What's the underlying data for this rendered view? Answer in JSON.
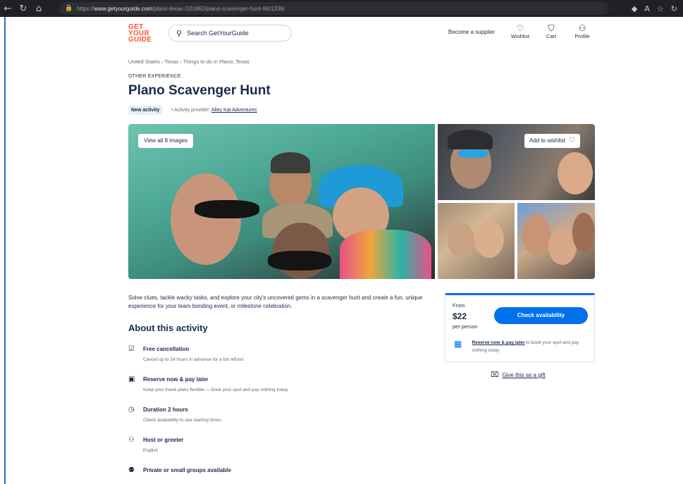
{
  "browser": {
    "url_prefix": "https://",
    "url_host": "www.getyourguide.com",
    "url_path": "/plano-texas-l101862/plano-scavenger-hunt-t601336/"
  },
  "header": {
    "logo_lines": [
      "GET",
      "YOUR",
      "GUIDE"
    ],
    "search_placeholder": "Search GetYourGuide",
    "become_supplier": "Become a supplier",
    "wishlist": "Wishlist",
    "cart": "Cart",
    "profile": "Profile"
  },
  "breadcrumb": "United States › Texas › Things to do in Plano, Texas",
  "overline": "OTHER EXPERIENCE",
  "title": "Plano Scavenger Hunt",
  "badge": "New activity",
  "provider_prefix": "• Activity provider:",
  "provider_name": "Alley Kat Adventures",
  "gallery": {
    "view_all": "View all 8 images",
    "add_wishlist": "Add to wishlist"
  },
  "description": "Solve clues, tackle wacky tasks, and explore your city's uncovered gems in a scavenger hunt and create a fun, unique experience for your team bonding event, or milestone celebration.",
  "about": {
    "heading": "About this activity",
    "features": [
      {
        "title": "Free cancellation",
        "detail": "Cancel up to 24 hours in advance for a full refund",
        "icon": "calendar-check-icon"
      },
      {
        "title": "Reserve now & pay later",
        "detail": "Keep your travel plans flexible — book your spot and pay nothing today.",
        "icon": "card-clock-icon"
      },
      {
        "title": "Duration 2 hours",
        "detail": "Check availability to see starting times.",
        "icon": "clock-icon"
      },
      {
        "title": "Host or greeter",
        "detail": "English",
        "icon": "person-speech-icon"
      },
      {
        "title": "Private or small groups available",
        "detail": "",
        "icon": "group-icon"
      }
    ]
  },
  "booking": {
    "from": "From",
    "price": "$22",
    "per": "per person",
    "cta": "Check availability",
    "reserve_link": "Reserve now & pay later",
    "reserve_text": " to book your spot and pay nothing today",
    "gift": "Give this as a gift"
  },
  "colors": {
    "brand_orange": "#ff5533",
    "primary_blue": "#0071eb",
    "text_dark": "#1a2b49"
  }
}
